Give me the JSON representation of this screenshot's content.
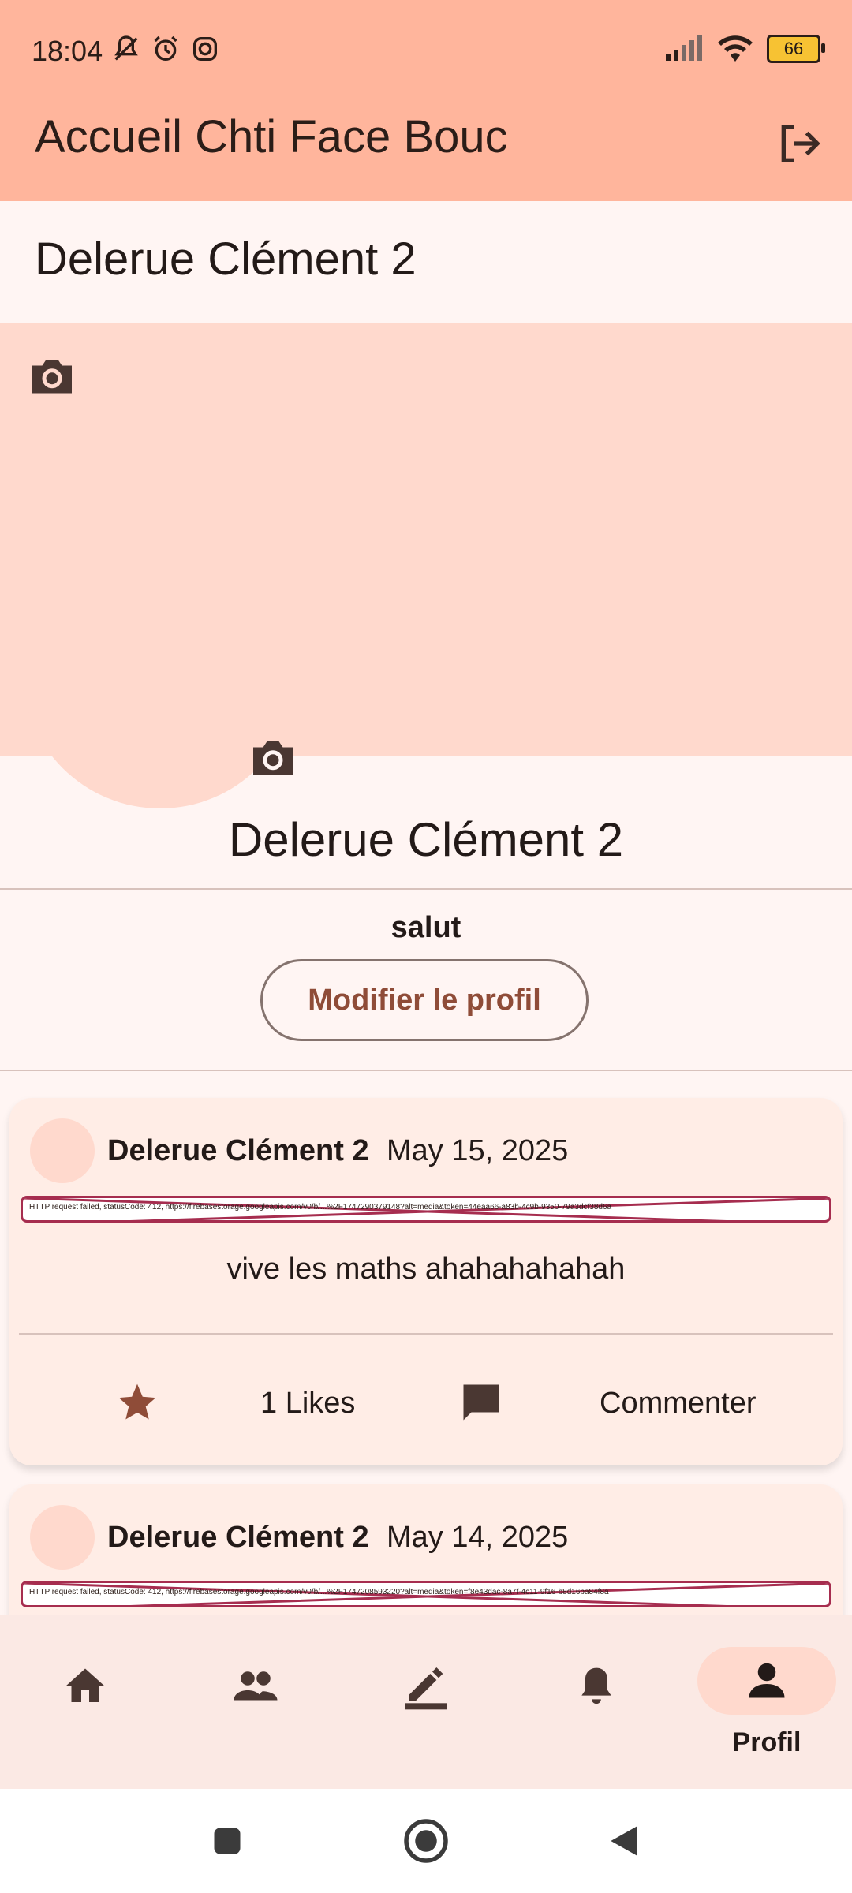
{
  "status_bar": {
    "time": "18:04",
    "battery": "66"
  },
  "app_bar": {
    "title": "Accueil Chti Face Bouc"
  },
  "header": {
    "user_name": "Delerue  Clément 2"
  },
  "profile": {
    "name": "Delerue  Clément 2",
    "bio": "salut",
    "edit_button": "Modifier le profil"
  },
  "posts": [
    {
      "author": "Delerue  Clément 2",
      "date": "May 15, 2025",
      "image_error": "HTTP request failed, statusCode: 412, https://firebasestorage.googleapis.com/v0/b/...%2F1747290379148?alt=media&token=44eaa66-a83b-4c9b-9350-79a3dcf38d6a",
      "text": "vive les maths ahahahahahah",
      "likes": "1 Likes",
      "comment_label": "Commenter"
    },
    {
      "author": "Delerue  Clément 2",
      "date": "May 14, 2025",
      "image_error": "HTTP request failed, statusCode: 412, https://firebasestorage.googleapis.com/v0/b/...%2F1747208593220?alt=media&token=f8e43dac-8a7f-4c11-9f16-b8d16ba84f8a"
    }
  ],
  "bottom_nav": {
    "items": [
      {
        "icon": "home-icon"
      },
      {
        "icon": "friends-icon"
      },
      {
        "icon": "edit-icon"
      },
      {
        "icon": "notifications-icon"
      },
      {
        "icon": "profile-icon",
        "label": "Profil",
        "active": true
      }
    ]
  },
  "colors": {
    "primary_container": "#ffb59c",
    "surface": "#fff5f3",
    "cover": "#ffd9cd",
    "accent": "#8f4c38"
  }
}
